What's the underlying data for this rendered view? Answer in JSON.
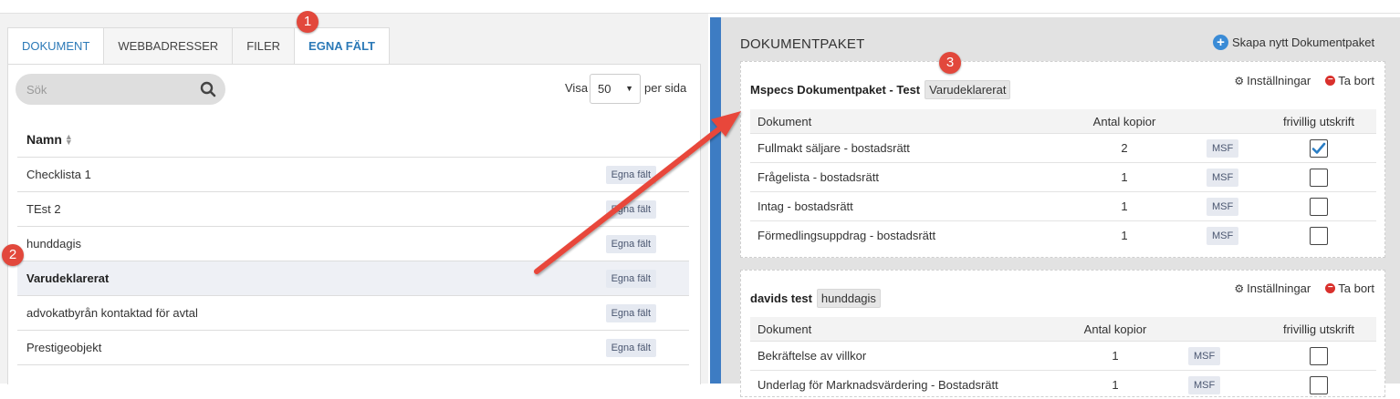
{
  "tabs": [
    "DOKUMENT",
    "WEBBADRESSER",
    "FILER",
    "EGNA FÄLT"
  ],
  "search": {
    "placeholder": "Sök"
  },
  "pager": {
    "visa": "Visa",
    "page_size": "50",
    "per_sida": "per sida"
  },
  "list": {
    "header": "Namn",
    "rows": [
      {
        "name": "Checklista 1",
        "badge": "Egna fält"
      },
      {
        "name": "TEst 2",
        "badge": "Egna fält"
      },
      {
        "name": "hunddagis",
        "badge": "Egna fält"
      },
      {
        "name": "Varudeklarerat",
        "badge": "Egna fält",
        "selected": true
      },
      {
        "name": "advokatbyrån kontaktad för avtal",
        "badge": "Egna fält"
      },
      {
        "name": "Prestigeobjekt",
        "badge": "Egna fält"
      }
    ]
  },
  "right": {
    "title": "DOKUMENTPAKET",
    "create_label": "Skapa nytt Dokumentpaket",
    "settings_label": "Inställningar",
    "remove_label": "Ta bort",
    "columns": [
      "Dokument",
      "Antal kopior",
      "frivillig utskrift"
    ],
    "packages": [
      {
        "name": "Mspecs Dokumentpaket - Test",
        "tag": "Varudeklarerat",
        "rows": [
          {
            "doc": "Fullmakt säljare - bostadsrätt",
            "copies": "2",
            "badge": "MSF",
            "optional": true
          },
          {
            "doc": "Frågelista - bostadsrätt",
            "copies": "1",
            "badge": "MSF",
            "optional": false
          },
          {
            "doc": "Intag - bostadsrätt",
            "copies": "1",
            "badge": "MSF",
            "optional": false
          },
          {
            "doc": "Förmedlingsuppdrag - bostadsrätt",
            "copies": "1",
            "badge": "MSF",
            "optional": false
          }
        ]
      },
      {
        "name": "davids test",
        "tag": "hunddagis",
        "rows": [
          {
            "doc": "Bekräftelse av villkor",
            "copies": "1",
            "badge": "MSF",
            "optional": false
          },
          {
            "doc": "Underlag för Marknadsvärdering - Bostadsrätt",
            "copies": "1",
            "badge": "MSF",
            "optional": false
          }
        ]
      }
    ]
  },
  "callouts": [
    "1",
    "2",
    "3"
  ],
  "colors": {
    "accent": "#3d7cc3",
    "link": "#2b79b7",
    "callout": "#e2483c",
    "arrow": "#e8463a"
  }
}
